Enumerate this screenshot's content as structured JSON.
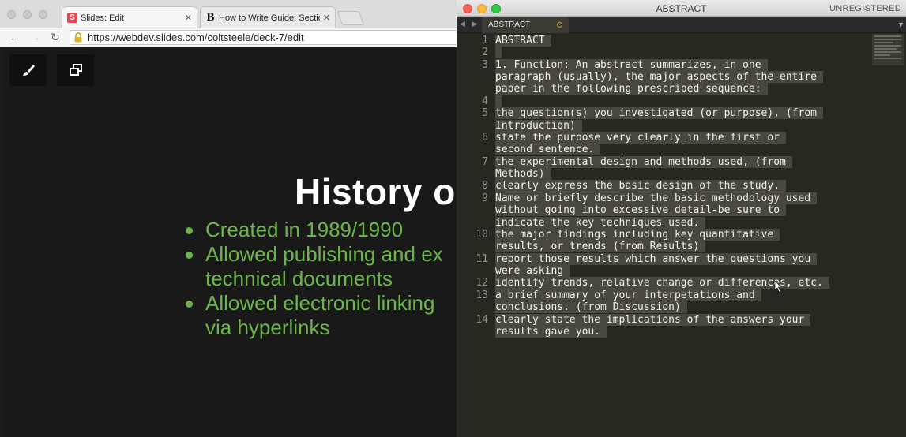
{
  "browser": {
    "tabs": [
      {
        "label": "Slides: Edit",
        "favicon": "S"
      },
      {
        "label": "How to Write Guide: Section",
        "favicon": "B"
      }
    ],
    "url": "https://webdev.slides.com/coltsteele/deck-7/edit"
  },
  "slide": {
    "title": "History o",
    "bullets": [
      [
        "Created in 1989/1990"
      ],
      [
        "Allowed publishing and ex",
        "technical documents"
      ],
      [
        "Allowed electronic linking",
        "via hyperlinks"
      ]
    ],
    "title_color": "#ffffff",
    "bullet_color": "#6bb54b"
  },
  "editor": {
    "window_title": "ABSTRACT",
    "license": "UNREGISTERED",
    "tab_label": "ABSTRACT",
    "lines": [
      {
        "n": "1",
        "text": [
          "ABSTRACT"
        ]
      },
      {
        "n": "2",
        "text": [
          ""
        ]
      },
      {
        "n": "3",
        "text": [
          "1. Function: An abstract summarizes, in one",
          "paragraph (usually), the major aspects of the entire",
          "paper in the following prescribed sequence:"
        ]
      },
      {
        "n": "4",
        "text": [
          ""
        ]
      },
      {
        "n": "5",
        "text": [
          "the question(s) you investigated (or purpose), (from",
          "Introduction)"
        ]
      },
      {
        "n": "6",
        "text": [
          "state the purpose very clearly in the first or",
          "second sentence."
        ]
      },
      {
        "n": "7",
        "text": [
          "the experimental design and methods used, (from",
          "Methods)"
        ]
      },
      {
        "n": "8",
        "text": [
          "clearly express the basic design of the study."
        ]
      },
      {
        "n": "9",
        "text": [
          "Name or briefly describe the basic methodology used",
          "without going into excessive detail-be sure to",
          "indicate the key techniques used."
        ]
      },
      {
        "n": "10",
        "text": [
          "the major findings including key quantitative",
          "results, or trends (from Results)"
        ]
      },
      {
        "n": "11",
        "text": [
          "report those results which answer the questions you",
          "were asking"
        ]
      },
      {
        "n": "12",
        "text": [
          "identify trends, relative change or differences, etc."
        ]
      },
      {
        "n": "13",
        "text": [
          "a brief summary of your interpetations and",
          "conclusions. (from Discussion)"
        ]
      },
      {
        "n": "14",
        "text": [
          "clearly state the implications of the answers your",
          "results gave you."
        ]
      }
    ],
    "background": "#272822",
    "selection_color": "#49483e"
  }
}
